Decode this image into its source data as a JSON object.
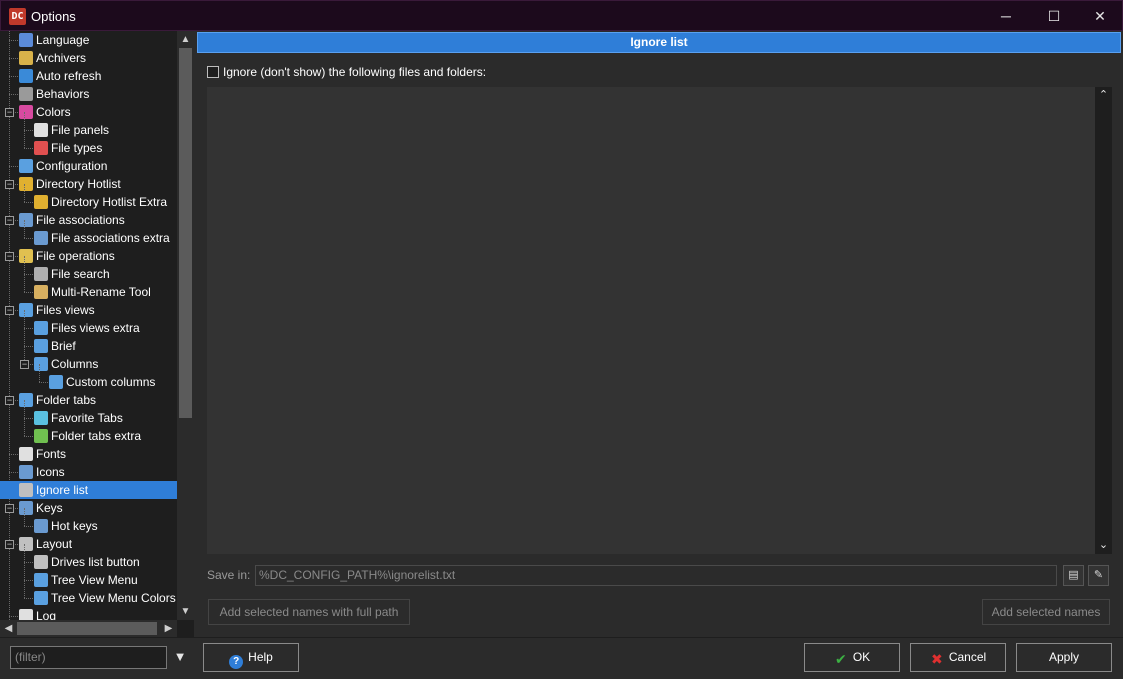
{
  "window": {
    "title": "Options",
    "app_icon": "DC",
    "minimize": "─",
    "maximize": "☐",
    "close": "✕"
  },
  "tree": {
    "items": [
      {
        "label": "Language",
        "icon": "flag-icon",
        "color": "#5b8bd8"
      },
      {
        "label": "Archivers",
        "icon": "archive-icon",
        "color": "#d8b24a"
      },
      {
        "label": "Auto refresh",
        "icon": "refresh-icon",
        "color": "#3a8ad8"
      },
      {
        "label": "Behaviors",
        "icon": "tools-icon",
        "color": "#9a9a9a"
      },
      {
        "label": "Colors",
        "icon": "color-wheel-icon",
        "color": "#d84aa0"
      },
      {
        "label": "File panels",
        "icon": "panels-icon",
        "color": "#e0e0e0"
      },
      {
        "label": "File types",
        "icon": "file-types-icon",
        "color": "#e05050"
      },
      {
        "label": "Configuration",
        "icon": "config-icon",
        "color": "#5aa0e0"
      },
      {
        "label": "Directory Hotlist",
        "icon": "hotlist-icon",
        "color": "#e0b030"
      },
      {
        "label": "Directory Hotlist Extra",
        "icon": "hotlist-extra-icon",
        "color": "#e0b030"
      },
      {
        "label": "File associations",
        "icon": "associations-icon",
        "color": "#6a9ad0"
      },
      {
        "label": "File associations extra",
        "icon": "associations-extra-icon",
        "color": "#6a9ad0"
      },
      {
        "label": "File operations",
        "icon": "file-ops-icon",
        "color": "#e0c050"
      },
      {
        "label": "File search",
        "icon": "binoculars-icon",
        "color": "#b0b0b0"
      },
      {
        "label": "Multi-Rename Tool",
        "icon": "rename-icon",
        "color": "#d8b060"
      },
      {
        "label": "Files views",
        "icon": "files-views-icon",
        "color": "#5aa0e0"
      },
      {
        "label": "Files views extra",
        "icon": "files-views-extra-icon",
        "color": "#5aa0e0"
      },
      {
        "label": "Brief",
        "icon": "brief-icon",
        "color": "#5aa0e0"
      },
      {
        "label": "Columns",
        "icon": "columns-icon",
        "color": "#5aa0e0"
      },
      {
        "label": "Custom columns",
        "icon": "custom-columns-icon",
        "color": "#5aa0e0"
      },
      {
        "label": "Folder tabs",
        "icon": "folder-tabs-icon",
        "color": "#5aa0e0"
      },
      {
        "label": "Favorite Tabs",
        "icon": "favorite-tabs-icon",
        "color": "#5ac0e0"
      },
      {
        "label": "Folder tabs extra",
        "icon": "folder-tabs-extra-icon",
        "color": "#70c050"
      },
      {
        "label": "Fonts",
        "icon": "fonts-icon",
        "color": "#e0e0e0"
      },
      {
        "label": "Icons",
        "icon": "icons-icon",
        "color": "#6a9ad0"
      },
      {
        "label": "Ignore list",
        "icon": "ignore-list-icon",
        "color": "#c0c0c0"
      },
      {
        "label": "Keys",
        "icon": "keyboard-icon",
        "color": "#6a9ad0"
      },
      {
        "label": "Hot keys",
        "icon": "hot-keys-icon",
        "color": "#6a9ad0"
      },
      {
        "label": "Layout",
        "icon": "layout-icon",
        "color": "#c0c0c0"
      },
      {
        "label": "Drives list button",
        "icon": "drives-icon",
        "color": "#c0c0c0"
      },
      {
        "label": "Tree View Menu",
        "icon": "tree-view-icon",
        "color": "#5aa0e0"
      },
      {
        "label": "Tree View Menu Colors",
        "icon": "tree-view-colors-icon",
        "color": "#5aa0e0"
      },
      {
        "label": "Log",
        "icon": "log-icon",
        "color": "#e0e0e0"
      }
    ]
  },
  "panel": {
    "header": "Ignore list",
    "checkbox_label": "Ignore (don't show) the following files and folders:",
    "save_in_label": "Save in:",
    "save_in_value": "%DC_CONFIG_PATH%\\ignorelist.txt",
    "add_full_path_button": "Add selected names with full path",
    "add_names_button": "Add selected names"
  },
  "bottom": {
    "filter_placeholder": "(filter)",
    "help": "Help",
    "ok": "OK",
    "cancel": "Cancel",
    "apply": "Apply"
  },
  "colors": {
    "accent": "#2f7ed8",
    "ok_icon": "#3cb043",
    "cancel_icon": "#e03030",
    "help_icon": "#2f7ed8"
  }
}
